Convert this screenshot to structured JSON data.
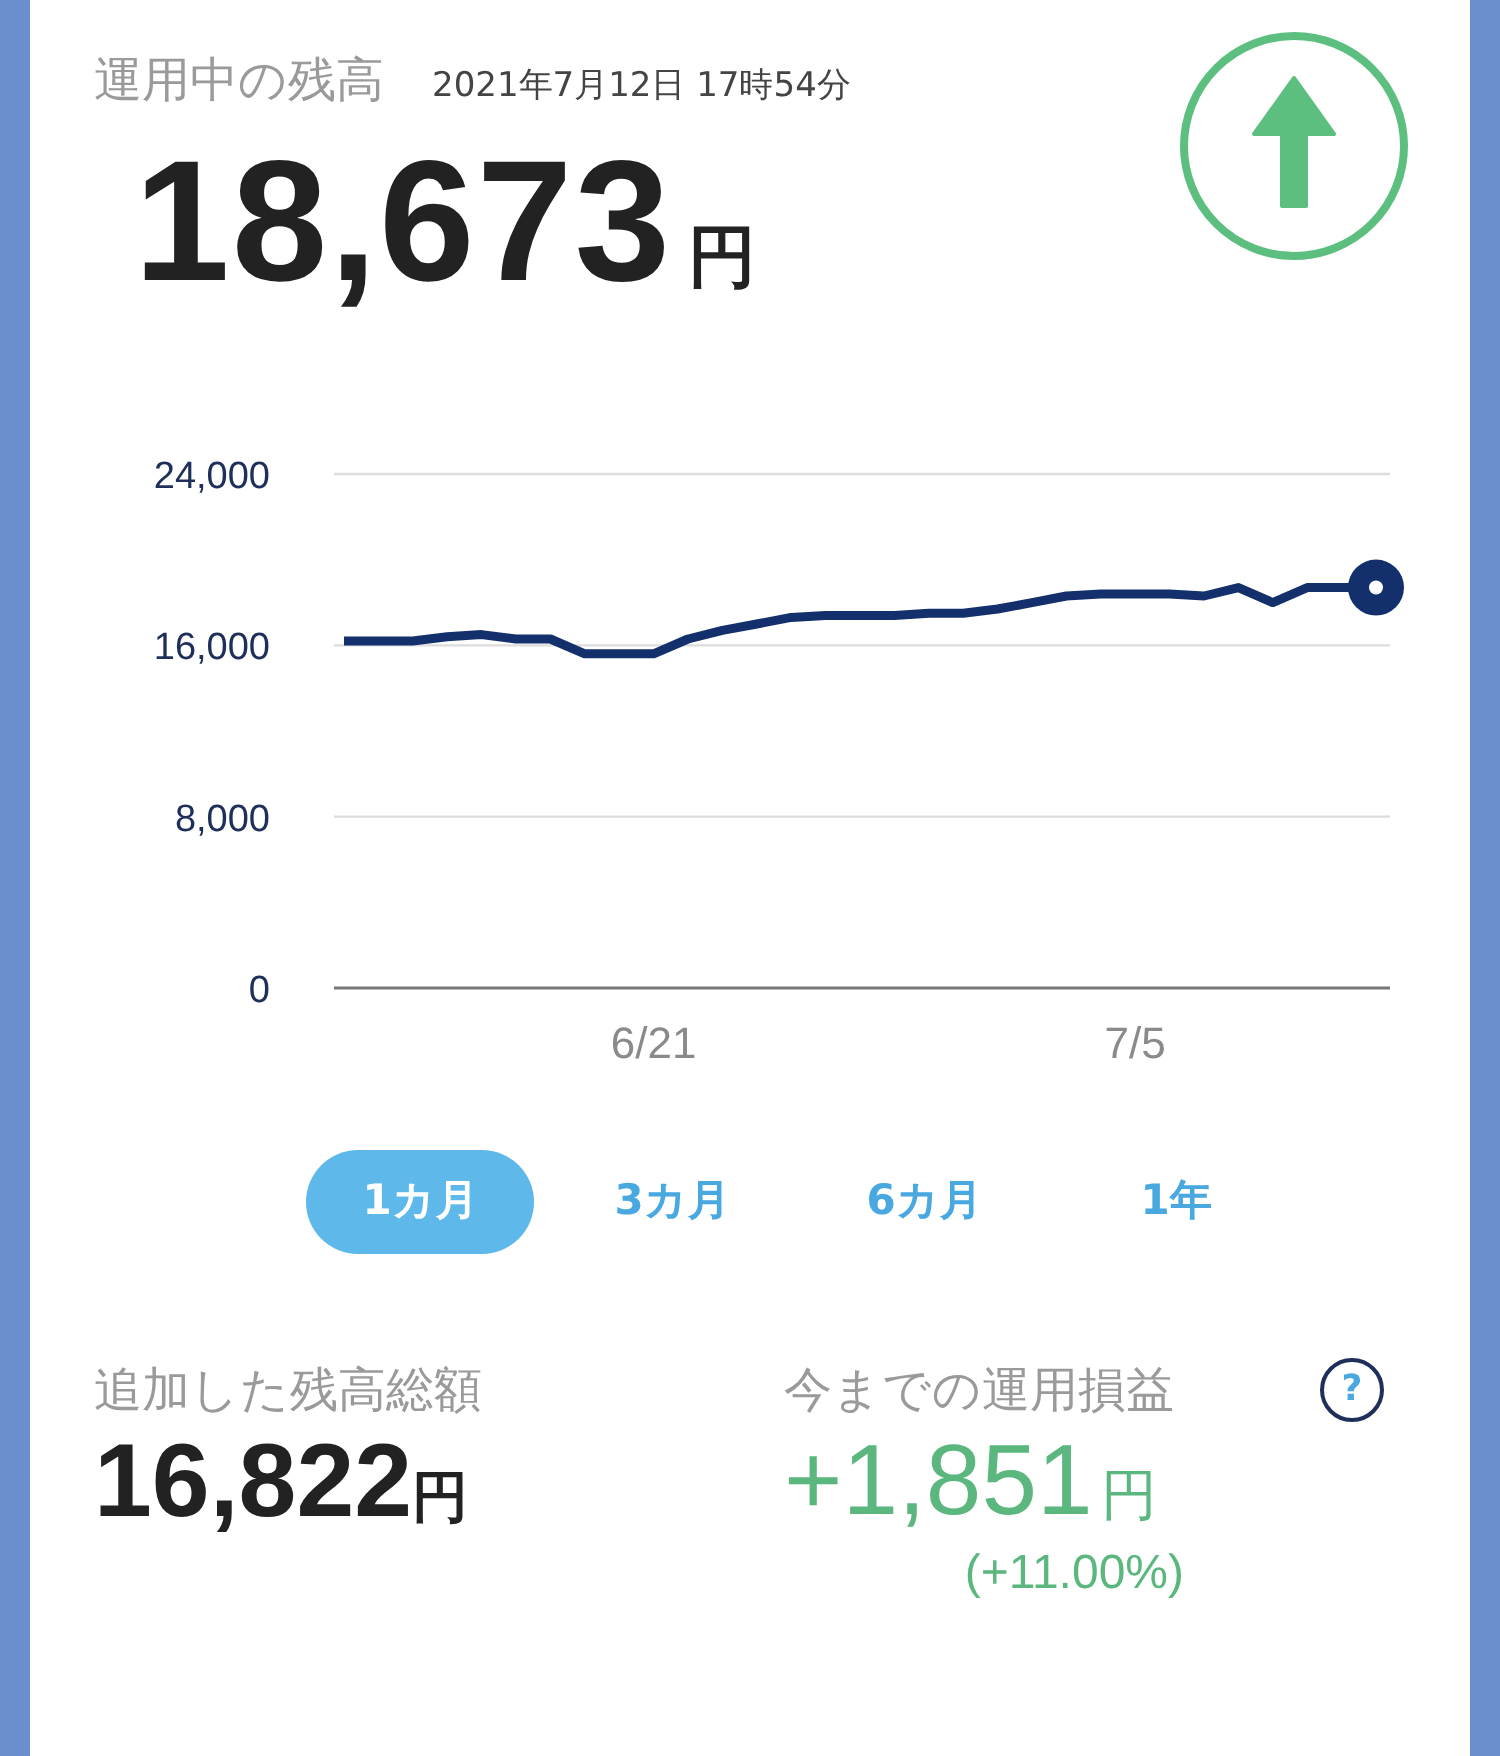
{
  "balance": {
    "label": "運用中の残高",
    "timestamp": "2021年7月12日 17時54分",
    "amount": "18,673",
    "unit": "円"
  },
  "chart_data": {
    "type": "line",
    "categories": [
      null,
      null,
      null,
      null,
      null,
      null,
      null,
      null,
      null,
      "6/21",
      null,
      null,
      null,
      null,
      null,
      null,
      null,
      null,
      null,
      null,
      null,
      null,
      null,
      "7/5",
      null,
      null,
      null,
      null,
      null,
      null,
      null
    ],
    "ylim": [
      0,
      24000
    ],
    "yticks": [
      {
        "value": 0,
        "label": "0"
      },
      {
        "value": 8000,
        "label": "8,000"
      },
      {
        "value": 16000,
        "label": "16,000"
      },
      {
        "value": 24000,
        "label": "24,000"
      }
    ],
    "series": [
      {
        "color": "#13306c",
        "values": [
          16200,
          16200,
          16200,
          16400,
          16500,
          16300,
          16300,
          15600,
          15600,
          15600,
          16300,
          16700,
          17000,
          17300,
          17400,
          17400,
          17400,
          17500,
          17500,
          17700,
          18000,
          18300,
          18400,
          18400,
          18400,
          18300,
          18700,
          18000,
          18700,
          18700,
          18700
        ]
      }
    ]
  },
  "periods": [
    {
      "label": "1カ月",
      "selected": true
    },
    {
      "label": "3カ月",
      "selected": false
    },
    {
      "label": "6カ月",
      "selected": false
    },
    {
      "label": "1年",
      "selected": false
    }
  ],
  "summary": {
    "deposited": {
      "label": "追加した残高総額",
      "amount": "16,822",
      "unit": "円"
    },
    "profit": {
      "label": "今までの運用損益",
      "help": "?",
      "amount": "+1,851",
      "unit": "円",
      "percent": "(+11.00%)"
    }
  }
}
